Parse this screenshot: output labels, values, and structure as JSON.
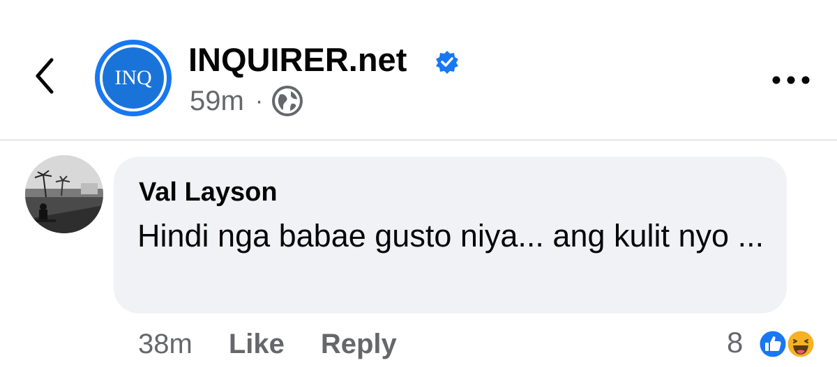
{
  "post": {
    "page_name": "INQUIRER.net",
    "avatar_text": "INQ",
    "time": "59m",
    "separator": "·",
    "privacy_icon": "globe-icon",
    "verified_icon": "verified-badge-icon",
    "more_icon": "more-horizontal-icon",
    "back_icon": "chevron-left-icon"
  },
  "comment": {
    "author": "Val Layson",
    "text": "Hindi nga babae gusto niya... ang kulit nyo ...",
    "time": "38m",
    "like_label": "Like",
    "reply_label": "Reply",
    "reaction_count": "8",
    "reactions": [
      "like-reaction-icon",
      "haha-reaction-icon"
    ]
  },
  "colors": {
    "brand_blue": "#1877f2",
    "secondary_text": "#65676b",
    "bubble_bg": "#f0f2f5",
    "haha_yellow": "#f7b125"
  }
}
